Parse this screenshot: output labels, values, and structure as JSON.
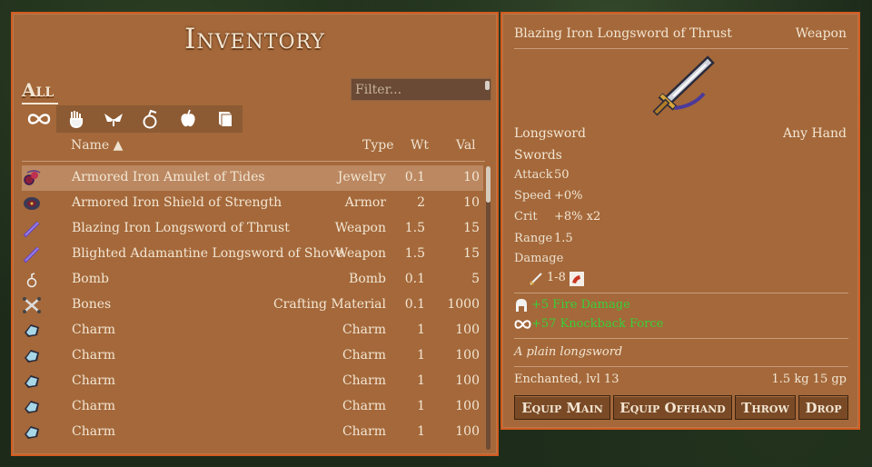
{
  "inventory": {
    "title": "Inventory",
    "all_tab": "All",
    "filter_placeholder": "Filter...",
    "categories": [
      "infinity-icon",
      "hand-icon",
      "wings-icon",
      "potion-icon",
      "apple-icon",
      "book-icon"
    ],
    "headers": {
      "name": "Name ▲",
      "type": "Type",
      "weight": "Wt",
      "value": "Val"
    },
    "items": [
      {
        "name": "Armored Iron Amulet of Tides",
        "type": "Jewelry",
        "wt": "0.1",
        "val": "10",
        "icon": "amulet-icon",
        "selected": true
      },
      {
        "name": "Armored Iron Shield of Strength",
        "type": "Armor",
        "wt": "2",
        "val": "10",
        "icon": "shield-icon"
      },
      {
        "name": "Blazing Iron Longsword of Thrust",
        "type": "Weapon",
        "wt": "1.5",
        "val": "15",
        "icon": "sword-icon"
      },
      {
        "name": "Blighted Adamantine Longsword of Shove",
        "type": "Weapon",
        "wt": "1.5",
        "val": "15",
        "icon": "sword-icon"
      },
      {
        "name": "Bomb",
        "type": "Bomb",
        "wt": "0.1",
        "val": "5",
        "icon": "bomb-icon"
      },
      {
        "name": "Bones",
        "type": "Crafting Material",
        "wt": "0.1",
        "val": "1000",
        "icon": "bones-icon"
      },
      {
        "name": "Charm",
        "type": "Charm",
        "wt": "1",
        "val": "100",
        "icon": "charm-icon"
      },
      {
        "name": "Charm",
        "type": "Charm",
        "wt": "1",
        "val": "100",
        "icon": "charm-icon"
      },
      {
        "name": "Charm",
        "type": "Charm",
        "wt": "1",
        "val": "100",
        "icon": "charm-icon"
      },
      {
        "name": "Charm",
        "type": "Charm",
        "wt": "1",
        "val": "100",
        "icon": "charm-icon"
      },
      {
        "name": "Charm",
        "type": "Charm",
        "wt": "1",
        "val": "100",
        "icon": "charm-icon"
      }
    ]
  },
  "details": {
    "name": "Blazing Iron Longsword of Thrust",
    "category": "Weapon",
    "subtype": "Longsword",
    "hand": "Any Hand",
    "skill": "Swords",
    "attack_label": "Attack",
    "attack": "50",
    "speed_label": "Speed",
    "speed": "+0%",
    "crit_label": "Crit",
    "crit": "+8% x2",
    "range_label": "Range",
    "range": "1.5",
    "damage_label": "Damage",
    "damage": "1-8",
    "bonus1": "+5 Fire Damage",
    "bonus2": "+57 Knockback Force",
    "description": "A plain longsword",
    "enchant": "Enchanted, lvl 13",
    "weight_value": "1.5 kg 15 gp",
    "buttons": {
      "equip_main": "Equip Main",
      "equip_offhand": "Equip Offhand",
      "throw": "Throw",
      "drop": "Drop"
    }
  },
  "colors": {
    "panel": "#a4683a",
    "border": "#d25b20",
    "selected_row": "#bb8861",
    "bonus": "#38d038"
  }
}
